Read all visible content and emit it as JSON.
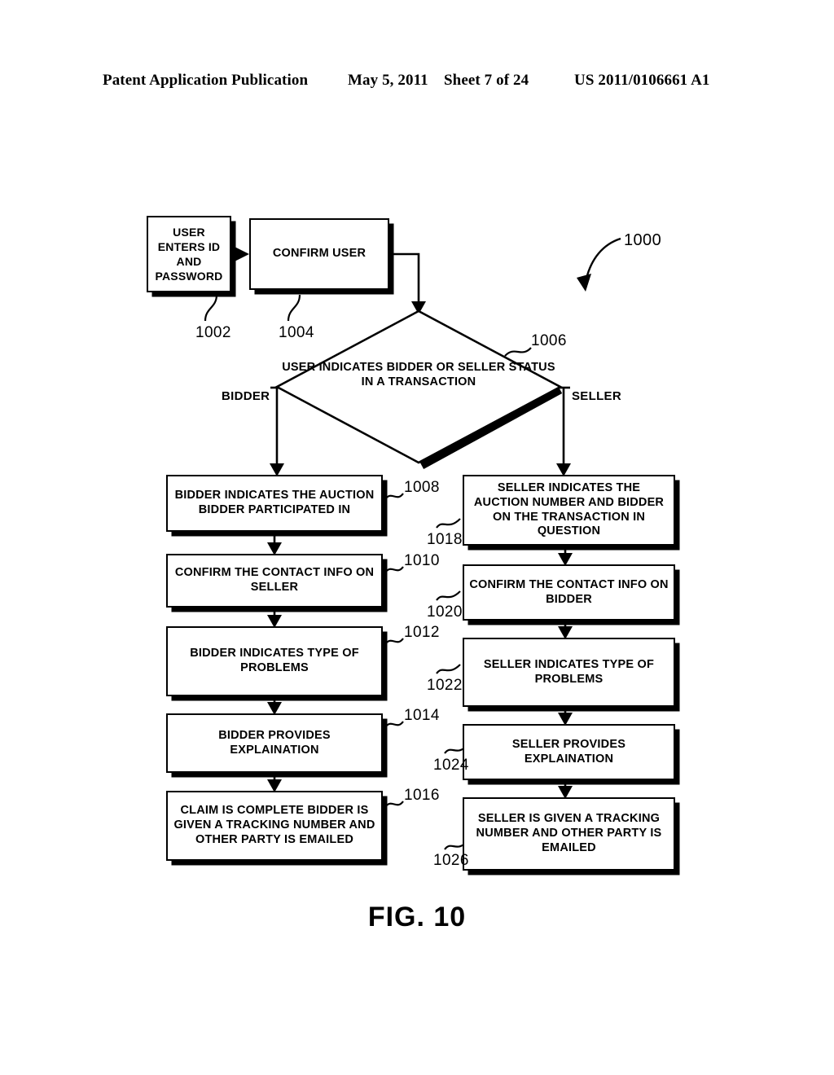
{
  "header": {
    "publication": "Patent Application Publication",
    "date": "May 5, 2011",
    "sheet": "Sheet 7 of 24",
    "patent_number": "US 2011/0106661 A1"
  },
  "figure": {
    "caption": "FIG. 10",
    "diagram_ref": "1000"
  },
  "nodes": {
    "start": {
      "ref": "1002",
      "text": "USER ENTERS ID AND PASSWORD"
    },
    "confirm_user": {
      "ref": "1004",
      "text": "CONFIRM USER"
    },
    "decision": {
      "ref": "1006",
      "text": "USER INDICATES BIDDER OR SELLER STATUS IN A TRANSACTION"
    },
    "bidder_1": {
      "ref": "1008",
      "text": "BIDDER INDICATES THE AUCTION BIDDER PARTICIPATED IN"
    },
    "bidder_2": {
      "ref": "1010",
      "text": "CONFIRM THE CONTACT INFO ON SELLER"
    },
    "bidder_3": {
      "ref": "1012",
      "text": "BIDDER INDICATES TYPE OF PROBLEMS"
    },
    "bidder_4": {
      "ref": "1014",
      "text": "BIDDER PROVIDES EXPLAINATION"
    },
    "bidder_5": {
      "ref": "1016",
      "text": "CLAIM IS COMPLETE BIDDER IS GIVEN A TRACKING NUMBER AND OTHER PARTY IS EMAILED"
    },
    "seller_1": {
      "ref": "1018",
      "text": "SELLER INDICATES THE AUCTION NUMBER AND BIDDER ON THE TRANSACTION IN QUESTION"
    },
    "seller_2": {
      "ref": "1020",
      "text": "CONFIRM THE CONTACT INFO ON BIDDER"
    },
    "seller_3": {
      "ref": "1022",
      "text": "SELLER INDICATES TYPE OF PROBLEMS"
    },
    "seller_4": {
      "ref": "1024",
      "text": "SELLER PROVIDES EXPLAINATION"
    },
    "seller_5": {
      "ref": "1026",
      "text": "SELLER IS GIVEN A TRACKING NUMBER AND OTHER PARTY IS EMAILED"
    }
  },
  "branches": {
    "left_label": "BIDDER",
    "right_label": "SELLER"
  },
  "colors": {
    "ink": "#000000",
    "paper": "#ffffff"
  }
}
